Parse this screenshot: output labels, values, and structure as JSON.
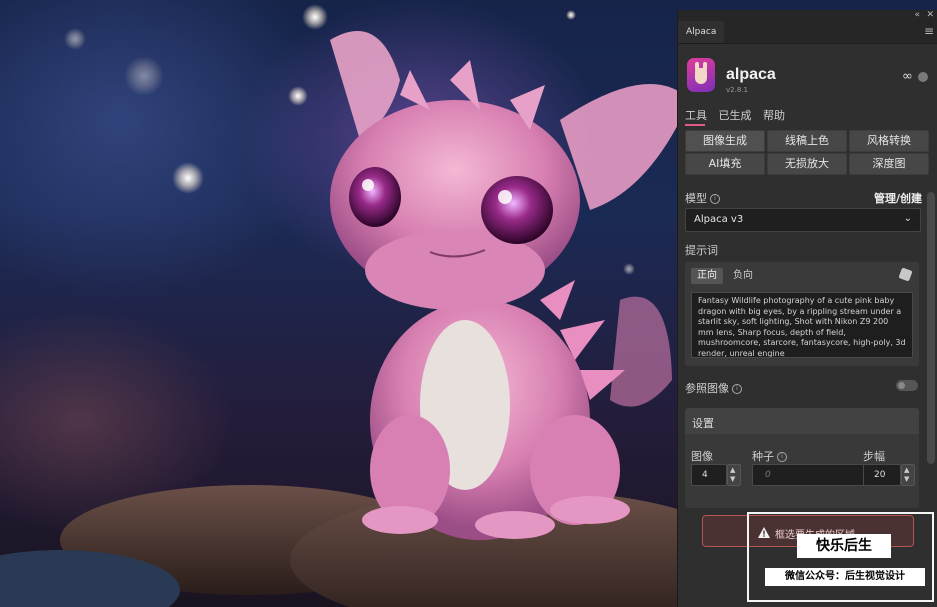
{
  "window": {
    "collapse_glyph": "«",
    "close_glyph": "✕"
  },
  "tab": {
    "label": "Alpaca",
    "menu_icon": "hamburger-icon"
  },
  "header": {
    "brand": "alpaca",
    "version": "v2.8.1",
    "link_glyph": "∞"
  },
  "nav": {
    "items": [
      "工具",
      "已生成",
      "帮助"
    ],
    "active": "工具"
  },
  "tools": {
    "row1": [
      "图像生成",
      "线稿上色",
      "风格转换"
    ],
    "row2": [
      "AI填充",
      "无损放大",
      "深度图"
    ],
    "active": "图像生成"
  },
  "model": {
    "label": "模型",
    "manage": "管理/创建",
    "selected": "Alpaca v3"
  },
  "prompt": {
    "label": "提示词",
    "tab_positive": "正向",
    "tab_negative": "负向",
    "text": "Fantasy Wildlife photography of a cute pink baby dragon with big eyes, by a rippling stream under a starlit sky, soft lighting, Shot with Nikon Z9 200 mm lens, Sharp focus, depth of field, mushroomcore, starcore, fantasycore, high-poly, 3d render, unreal engine"
  },
  "reference": {
    "label": "参照图像",
    "enabled": false
  },
  "settings": {
    "title": "设置",
    "image_label": "图像",
    "image_value": "4",
    "seed_label": "种子",
    "seed_placeholder": "0",
    "steps_label": "步幅",
    "steps_value": "20"
  },
  "generate": {
    "warning": "框选要生成的区域",
    "warning_icon": "warning-icon"
  },
  "watermark": {
    "title": "快乐后生",
    "subtitle": "微信公众号：后生视觉设计"
  },
  "colors": {
    "accent": "#e05a8a",
    "panel_bg": "#2f2f2f",
    "warn_border": "#b2564f"
  }
}
